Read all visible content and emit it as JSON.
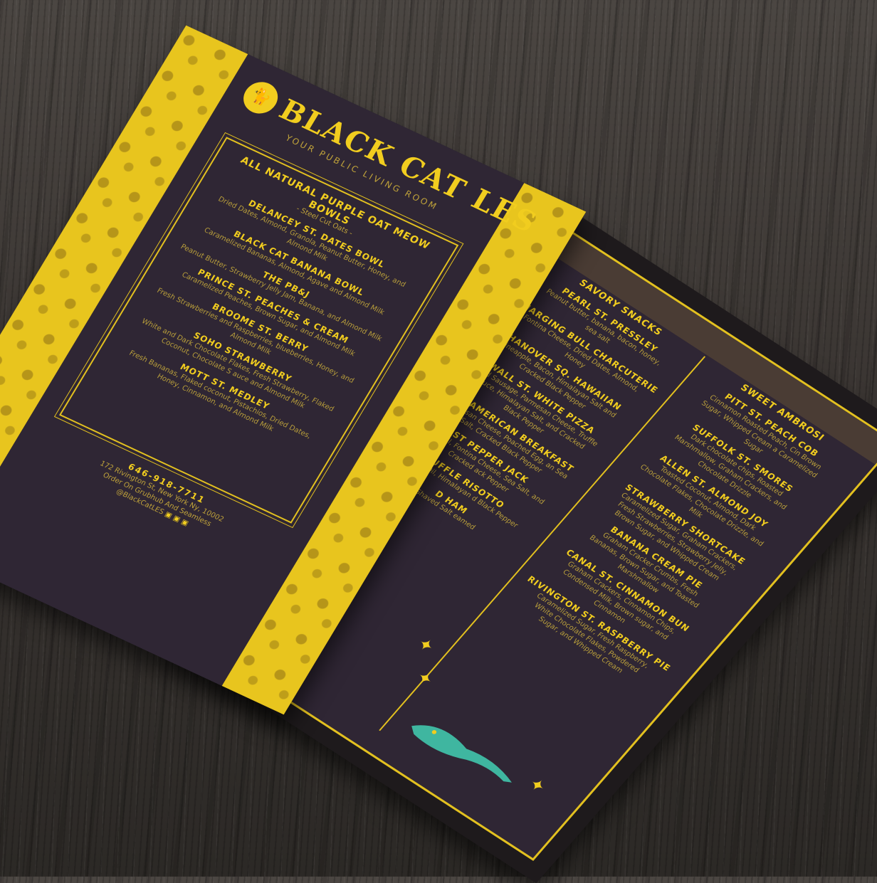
{
  "front": {
    "brand": "BLACK CAT LES",
    "tagline": "YOUR PUBLIC LIVING ROOM",
    "section_title": "ALL NATURAL PURPLE OAT MEOW BOWLS",
    "section_sub": "- Steel Cut Oats -",
    "items": [
      {
        "name": "DELANCEY ST. DATES BOWL",
        "desc": "Dried Dates, Almond, Granola, Peanut Butter, Honey, and Almond Milk"
      },
      {
        "name": "BLACK CAT BANANA BOWL",
        "desc": "Caramelized Bananas, Almond, Agave and Almond Milk"
      },
      {
        "name": "THE PB&J",
        "desc": "Peanut Butter, Strawberry Jelly Jam, Banana, and Almond Milk"
      },
      {
        "name": "PRINCE ST. PEACHES & CREAM",
        "desc": "Caramelized Peaches, Brown Sugar, and Almond Milk"
      },
      {
        "name": "BROOME ST. BERRY",
        "desc": "Fresh Strawberries and Raspberries, blueberries, Honey, and Almond Milk"
      },
      {
        "name": "SOHO STRAWBERRY",
        "desc": "White and Dark Chocolate Flakes, Fresh Strawberry, Flaked Coconut, Chocolate S auce and Almond Milk"
      },
      {
        "name": "MOTT ST. MEDLEY",
        "desc": "Fresh Bananas, Flaked coconut, Pistachios, Dried Dates, Honey, Cinnamon, and Almond Milk"
      }
    ],
    "phone": "646-918-7711",
    "address": "172 Rivington St, New York Ny, 10002",
    "order": "Order On Grubhub And Seamless",
    "handle": "@BlackCatLES"
  },
  "back": {
    "left_title": "SAVORY SNACKS",
    "right_title": "SWEET AMBROSI",
    "left_items": [
      {
        "name": "PEARL ST. PRESSLEY",
        "desc": "Peanut butter, banana, bacon, honey, sea salt"
      },
      {
        "name": "CHARGING BULL CHARCUTERIE",
        "desc": "Fontina Cheese, Dried Dates, Almond, Honey"
      },
      {
        "name": "HANOVER SQ. HAWAIIAN",
        "desc": "Pineapple, Bacon, Himalayan Salt and Cracked Black Pepper"
      },
      {
        "name": "WALL ST. WHITE PIZZA",
        "desc": "Aged Sausage, Parmesan Cheese, Truffle Sauce, Himalayan Salt, and Cracked Black Pepper"
      },
      {
        "name": "ST. AMERICAN BREAKFAST",
        "desc": "Parmesan Cheese, Poached Egg, an Sea Salt, Cracked Black Pepper"
      },
      {
        "name": "ST PEPPER JACK",
        "desc": "Olive Oil, Fontina Cheese, Sea Salt, and Cracked ack Pepper"
      },
      {
        "name": "UFFLE RISOTTO",
        "desc": "Truffle Oil, Himalayan d Black Pepper"
      },
      {
        "name": "D HAM",
        "desc": "Shaved Salt eamed"
      }
    ],
    "right_items": [
      {
        "name": "PITT ST. PEACH COB",
        "desc": "Cinnamon Roasted Peach, Cin Brown Sugar, Whipped Cream a Caramelized Sugar"
      },
      {
        "name": "SUFFOLK ST. SMORES",
        "desc": "Dark chocolate chips, Roasted Marshmallow, Graham Crackers, and Chocolate Drizzle"
      },
      {
        "name": "ALLEN ST. ALMOND JOY",
        "desc": "Toasted Coconut, Almond, Dark Chocolate Flakes, Chocolate Drizzle, and Milk"
      },
      {
        "name": "STRAWBERRY SHORTCAKE",
        "desc": "Caramelized Sugar, Graham Crackers, Fresh Strawberries, Strawberry Jelly, Brown Sugar, and Whipped Cream"
      },
      {
        "name": "BANANA CREAM PIE",
        "desc": "Graham Cracker Crumbs, Fresh Bananas, Brown Sugar, and Toasted Marshmallow"
      },
      {
        "name": "CANAL ST. CINNAMON BUN",
        "desc": "Graham Crackers, Cinnamon Chips, Condensed Milk, Brown sugar, and Cinnamon"
      },
      {
        "name": "RIVINGTON ST. RASPBERRY PIE",
        "desc": "Caramelized Sugar, Fresh Raspberry, White Chocolate Flakes, Powdered Sugar, and Whipped Cream"
      }
    ]
  },
  "colors": {
    "accent": "#f1cd1f",
    "panel": "#2f2634",
    "cat": "#3fb6a0"
  }
}
